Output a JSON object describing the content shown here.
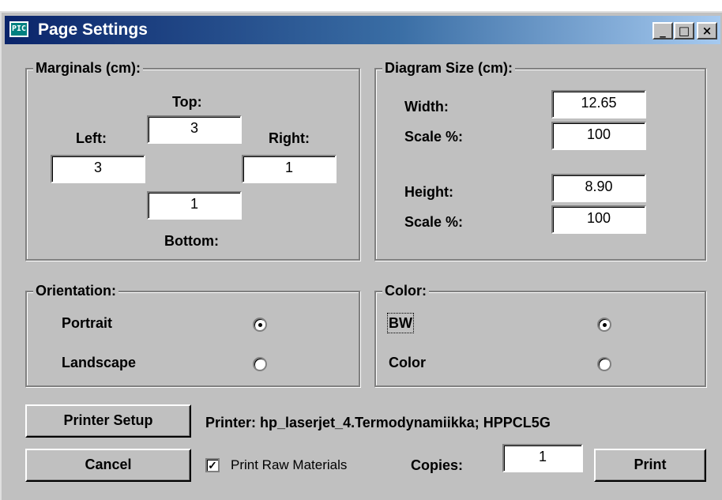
{
  "window": {
    "title": "Page Settings",
    "app_icon_text": "PIC",
    "controls": {
      "minimize": "_",
      "maximize": "□",
      "close": "×"
    }
  },
  "margins": {
    "legend": "Marginals (cm):",
    "top_label": "Top:",
    "top_value": "3",
    "left_label": "Left:",
    "left_value": "3",
    "right_label": "Right:",
    "right_value": "1",
    "bottom_label": "Bottom:",
    "bottom_value": "1"
  },
  "diagram": {
    "legend": "Diagram Size (cm):",
    "width_label": "Width:",
    "width_value": "12.65",
    "width_scale_label": "Scale %:",
    "width_scale_value": "100",
    "height_label": "Height:",
    "height_value": "8.90",
    "height_scale_label": "Scale %:",
    "height_scale_value": "100"
  },
  "orientation": {
    "legend": "Orientation:",
    "options": [
      {
        "label": "Portrait",
        "selected": true
      },
      {
        "label": "Landscape",
        "selected": false
      }
    ]
  },
  "color": {
    "legend": "Color:",
    "options": [
      {
        "label": "BW",
        "selected": true
      },
      {
        "label": "Color",
        "selected": false
      }
    ]
  },
  "printer": {
    "setup_label": "Printer Setup",
    "info": "Printer: hp_laserjet_4.Termodynamiikka; HPPCL5G"
  },
  "footer": {
    "cancel_label": "Cancel",
    "raw_checkbox_checked": true,
    "raw_checkbox_label": "Print Raw Materials",
    "copies_label": "Copies:",
    "copies_value": "1",
    "print_label": "Print"
  }
}
